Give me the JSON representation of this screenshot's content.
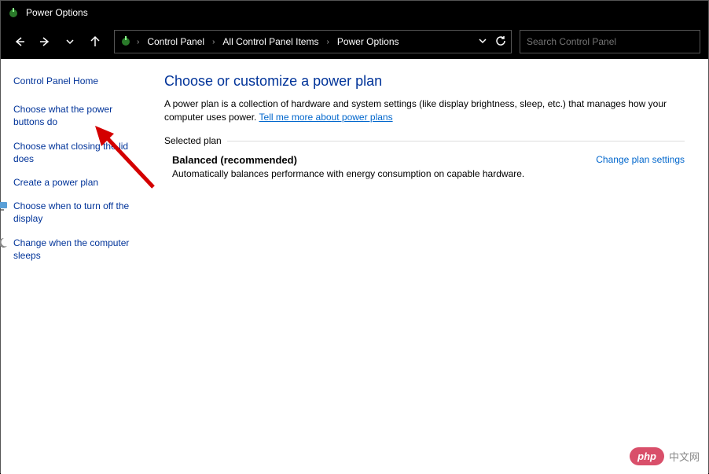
{
  "window": {
    "title": "Power Options"
  },
  "breadcrumb": {
    "items": [
      "Control Panel",
      "All Control Panel Items",
      "Power Options"
    ]
  },
  "search": {
    "placeholder": "Search Control Panel"
  },
  "sidebar": {
    "home": "Control Panel Home",
    "items": [
      "Choose what the power buttons do",
      "Choose what closing the lid does",
      "Create a power plan",
      "Choose when to turn off the display",
      "Change when the computer sleeps"
    ]
  },
  "main": {
    "heading": "Choose or customize a power plan",
    "desc": "A power plan is a collection of hardware and system settings (like display brightness, sleep, etc.) that manages how your computer uses power. ",
    "desc_link": "Tell me more about power plans",
    "section_label": "Selected plan",
    "plan_name": "Balanced (recommended)",
    "plan_sub": "Automatically balances performance with energy consumption on capable hardware.",
    "change_link": "Change plan settings"
  },
  "watermark": {
    "pill": "php",
    "text": "中文网"
  }
}
